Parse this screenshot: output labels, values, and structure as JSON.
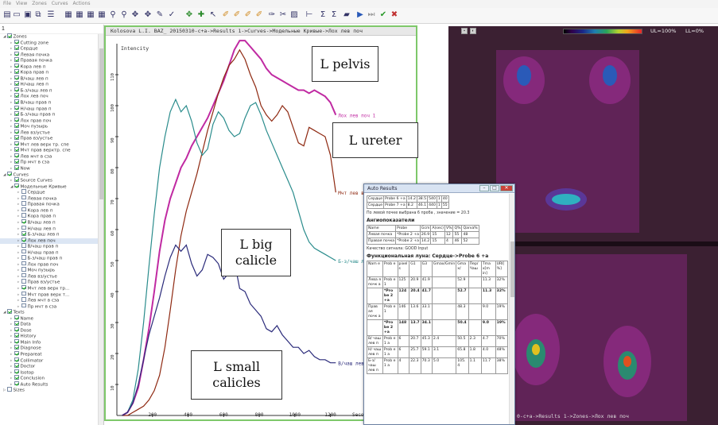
{
  "menu": [
    "File",
    "View",
    "Zones",
    "Curves",
    "Actions"
  ],
  "tree": {
    "header_value": "1",
    "rows": [
      {
        "level": 1,
        "label": "Zones",
        "checked": true,
        "expanded": true
      },
      {
        "level": 2,
        "label": "Cutting zone",
        "checked": true
      },
      {
        "level": 2,
        "label": "Сердце",
        "checked": true
      },
      {
        "level": 2,
        "label": "Левая почка",
        "checked": true
      },
      {
        "level": 2,
        "label": "Правая почка",
        "checked": true
      },
      {
        "level": 2,
        "label": "Кора лев п",
        "checked": true
      },
      {
        "level": 2,
        "label": "Кора прав п",
        "checked": true
      },
      {
        "level": 2,
        "label": "В/чаш лев п",
        "checked": true
      },
      {
        "level": 2,
        "label": "Н/чаш лев п",
        "checked": true
      },
      {
        "level": 2,
        "label": "Б-з/чаш лев п",
        "checked": true
      },
      {
        "level": 2,
        "label": "Лох лев поч",
        "checked": true
      },
      {
        "level": 2,
        "label": "В/чаш прав п",
        "checked": true
      },
      {
        "level": 2,
        "label": "Н/чаш прав п",
        "checked": true
      },
      {
        "level": 2,
        "label": "Б-з/чаш прав п",
        "checked": true
      },
      {
        "level": 2,
        "label": "Лох прав поч",
        "checked": true
      },
      {
        "level": 2,
        "label": "Моч пузырь",
        "checked": true
      },
      {
        "level": 2,
        "label": "Лев вз/устье",
        "checked": true
      },
      {
        "level": 2,
        "label": "Прав вз/устье",
        "checked": true
      },
      {
        "level": 2,
        "label": "Мчт лев верх тр. спе",
        "checked": true
      },
      {
        "level": 2,
        "label": "Мчт прав верхтр. спе",
        "checked": true
      },
      {
        "level": 2,
        "label": "Лев мчт в сза",
        "checked": true
      },
      {
        "level": 2,
        "label": "Пр мчт в сза",
        "checked": true
      },
      {
        "level": 2,
        "label": "Now",
        "checked": true
      },
      {
        "level": 1,
        "label": "Curves",
        "checked": true,
        "expanded": true
      },
      {
        "level": 2,
        "label": "Source Curves",
        "checked": true
      },
      {
        "level": 2,
        "label": "Модельные Кривые",
        "checked": true,
        "expanded": true
      },
      {
        "level": 3,
        "label": "Сердце",
        "checked": false
      },
      {
        "level": 3,
        "label": "Левая почка",
        "checked": false
      },
      {
        "level": 3,
        "label": "Правая почка",
        "checked": false
      },
      {
        "level": 3,
        "label": "Кора лев п",
        "checked": false
      },
      {
        "level": 3,
        "label": "Кора прав п",
        "checked": false
      },
      {
        "level": 3,
        "label": "В/чаш лев п",
        "checked": true
      },
      {
        "level": 3,
        "label": "Н/чаш лев п",
        "checked": false
      },
      {
        "level": 3,
        "label": "Б-з/чаш лев п",
        "checked": true
      },
      {
        "level": 3,
        "label": "Лох лев поч",
        "checked": true,
        "selected": true
      },
      {
        "level": 3,
        "label": "В/чаш прав п",
        "checked": false
      },
      {
        "level": 3,
        "label": "Н/чаш прав п",
        "checked": false
      },
      {
        "level": 3,
        "label": "Б-з/чаш прав п",
        "checked": false
      },
      {
        "level": 3,
        "label": "Лох прав поч",
        "checked": false
      },
      {
        "level": 3,
        "label": "Моч пузырь",
        "checked": false
      },
      {
        "level": 3,
        "label": "Лев вз/устье",
        "checked": false
      },
      {
        "level": 3,
        "label": "Прав вз/устье",
        "checked": false
      },
      {
        "level": 3,
        "label": "Мчт лев верх тр...",
        "checked": true
      },
      {
        "level": 3,
        "label": "Мчт прав верх т...",
        "checked": false
      },
      {
        "level": 3,
        "label": "Лев мчт в сза",
        "checked": false
      },
      {
        "level": 3,
        "label": "Пр мчт в сза",
        "checked": false
      },
      {
        "level": 1,
        "label": "Texts",
        "checked": true,
        "expanded": true
      },
      {
        "level": 2,
        "label": "Name",
        "checked": true
      },
      {
        "level": 2,
        "label": "Data",
        "checked": true
      },
      {
        "level": 2,
        "label": "Dose",
        "checked": true
      },
      {
        "level": 2,
        "label": "History",
        "checked": true
      },
      {
        "level": 2,
        "label": "Main Info",
        "checked": true
      },
      {
        "level": 2,
        "label": "Diagnose",
        "checked": true
      },
      {
        "level": 2,
        "label": "Prepareat",
        "checked": true
      },
      {
        "level": 2,
        "label": "Collimator",
        "checked": true
      },
      {
        "level": 2,
        "label": "Doctor",
        "checked": true
      },
      {
        "level": 2,
        "label": "Isotop",
        "checked": true
      },
      {
        "level": 2,
        "label": "Conclusion",
        "checked": true
      },
      {
        "level": 2,
        "label": "Auto Results",
        "checked": true
      },
      {
        "level": 1,
        "label": "Sizes",
        "checked": false,
        "expanded": false
      }
    ]
  },
  "chart_window": {
    "title": "Kolosova L.I. BAZ_ 20150310-c+a->Results 1->Curves->Модельные Кривые->Лох лев поч"
  },
  "chart_data": {
    "type": "line",
    "ylabel": "Intencity",
    "xlabel": "Seconds",
    "xlim": [
      0,
      1260
    ],
    "ylim": [
      0,
      120
    ],
    "xticks": [
      200,
      400,
      600,
      800,
      1000,
      1200
    ],
    "yticks": [
      10,
      20,
      30,
      40,
      50,
      60,
      70,
      80,
      90,
      100,
      110
    ],
    "series": [
      {
        "name": "Лох лев поч 1",
        "color": "#c02aa2",
        "x": [
          30,
          60,
          90,
          120,
          150,
          180,
          210,
          240,
          270,
          300,
          330,
          360,
          390,
          420,
          450,
          480,
          510,
          540,
          570,
          600,
          630,
          660,
          690,
          720,
          750,
          780,
          810,
          840,
          870,
          900,
          930,
          960,
          990,
          1020,
          1050,
          1080,
          1110,
          1140,
          1170,
          1200,
          1230
        ],
        "y": [
          0,
          1,
          4,
          9,
          18,
          28,
          40,
          53,
          63,
          70,
          75,
          80,
          83,
          87,
          90,
          93,
          96,
          100,
          104,
          108,
          113,
          118,
          121,
          121,
          119,
          117,
          115,
          112,
          110,
          109,
          108,
          107,
          106,
          105,
          105,
          104,
          105,
          104,
          103,
          101,
          97
        ]
      },
      {
        "name": "Мчт лев верх тр.",
        "color": "#8e2810",
        "x": [
          30,
          60,
          90,
          120,
          150,
          180,
          210,
          240,
          270,
          300,
          330,
          360,
          390,
          420,
          450,
          480,
          510,
          540,
          570,
          600,
          630,
          660,
          690,
          720,
          750,
          780,
          810,
          840,
          870,
          900,
          930,
          960,
          990,
          1020,
          1050,
          1080,
          1110,
          1140,
          1170,
          1200,
          1230
        ],
        "y": [
          0,
          0,
          1,
          2,
          3,
          5,
          8,
          13,
          22,
          34,
          47,
          58,
          66,
          72,
          78,
          85,
          92,
          98,
          104,
          109,
          113,
          115,
          118,
          115,
          110,
          106,
          100,
          97,
          95,
          97,
          100,
          98,
          93,
          88,
          87,
          93,
          92,
          91,
          90,
          84,
          72
        ]
      },
      {
        "name": "Б-з/чаш лев",
        "color": "#2a8c8c",
        "x": [
          30,
          60,
          90,
          120,
          150,
          180,
          210,
          240,
          270,
          300,
          330,
          360,
          390,
          420,
          450,
          480,
          510,
          540,
          570,
          600,
          630,
          660,
          690,
          720,
          750,
          780,
          810,
          840,
          870,
          900,
          930,
          960,
          990,
          1020,
          1050,
          1080,
          1110,
          1140,
          1170,
          1200,
          1230
        ],
        "y": [
          0,
          1,
          5,
          15,
          30,
          48,
          65,
          80,
          90,
          98,
          102,
          98,
          100,
          95,
          88,
          84,
          86,
          94,
          98,
          96,
          92,
          90,
          91,
          96,
          100,
          101,
          97,
          92,
          88,
          84,
          80,
          76,
          72,
          66,
          60,
          56,
          54,
          53,
          52,
          51,
          50
        ]
      },
      {
        "name": "В/чаш лев",
        "color": "#2a2a7a",
        "x": [
          30,
          60,
          90,
          120,
          150,
          180,
          210,
          240,
          270,
          300,
          330,
          360,
          390,
          420,
          450,
          480,
          510,
          540,
          570,
          600,
          630,
          660,
          690,
          720,
          750,
          780,
          810,
          840,
          870,
          900,
          930,
          960,
          990,
          1020,
          1050,
          1080,
          1110,
          1140,
          1170,
          1200,
          1230
        ],
        "y": [
          0,
          1,
          4,
          10,
          18,
          26,
          32,
          38,
          45,
          51,
          55,
          53,
          55,
          49,
          45,
          47,
          52,
          51,
          49,
          44,
          46,
          50,
          41,
          40,
          36,
          34,
          32,
          28,
          27,
          29,
          26,
          24,
          22,
          22,
          20,
          21,
          19,
          18,
          18,
          17,
          17
        ]
      }
    ]
  },
  "annotations": {
    "pelvis": "L pelvis",
    "ureter": "L ureter",
    "big_calicle": "L big\ncalicle",
    "small_calicles": "L small\ncalicles"
  },
  "image_panel": {
    "ul_label": "UL=100%",
    "ll_label": "LL=0%",
    "status": "0-c+a->Results 1->Zones->Лох лев поч"
  },
  "popup": {
    "title": "Auto Results",
    "top_table": [
      [
        "Сердце",
        "Probe 6 +a",
        "14.2",
        "38.5",
        "540",
        "1",
        "40"
      ],
      [
        "Сердце",
        "Probe 7 +a",
        "8.2",
        "46.1",
        "440",
        "1",
        "55"
      ]
    ],
    "note1": "По левой почке выбрана 6 проба , значение = 20.3",
    "heading1": "Ангиопоказатели",
    "angio_header": [
      "Name",
      "Probe",
      "Gcm",
      "A(sec)",
      "V%",
      "Q%",
      "Qarva%"
    ],
    "angio_rows": [
      [
        "Левая почка",
        "*Probe 2 +a",
        "26.9",
        "15",
        "12",
        "55",
        "48"
      ],
      [
        "Правая почка",
        "*Probe 2 +a",
        "14.2",
        "15",
        "4",
        "46",
        "52"
      ]
    ],
    "note2": "Качество сигнала: GOOD Input",
    "heading2": "Функциональная луна: Сердце->Probe 6 +a",
    "func_header": [
      "Nam e",
      "Prob e",
      "pixel s",
      "G1",
      "G3",
      "Gmax/Gmin",
      "Gma x/",
      "Пер/ Чаш",
      "Tma x[m in]",
      "URI[ %]"
    ],
    "func_rows": [
      [
        "Лева я почк а",
        "Prob e 1",
        "125",
        "20.9",
        "41.9",
        "",
        "52.9",
        "",
        "11.3",
        "32%"
      ],
      [
        "",
        "*Pro be 2 +a",
        "124",
        "20.4",
        "41.7",
        "",
        "52.7",
        "",
        "11.3",
        "32%"
      ],
      [
        "Прав ая почк а",
        "Prob e 1",
        "146",
        "13.6",
        "33.1",
        "",
        "48.3",
        "",
        "9.0",
        "19%"
      ],
      [
        "",
        "*Pro be 2 +a",
        "148",
        "13.7",
        "34.1",
        "",
        "50.4",
        "",
        "9.0",
        "19%"
      ],
      [
        "В/ чаш лев п",
        "Prob e 1 a",
        "6",
        "20.7",
        "45.3",
        "2.4",
        "50.5",
        "2.3",
        "4.7",
        "70%"
      ],
      [
        "Н/ чаш лев п",
        "Prob e 1 a",
        "6",
        "25.7",
        "59.1",
        "3.1",
        "65.8",
        "1.8",
        "4.0",
        "48%"
      ],
      [
        "Б-з/ чаш лев п",
        "Prob e 1 a",
        "4",
        "22.3",
        "70.3",
        "5.0",
        "105. 4",
        "1.1",
        "11.7",
        "38%"
      ]
    ]
  },
  "colors": {
    "chart_border": "#7ec86a",
    "image_bg": "#3b2032"
  }
}
